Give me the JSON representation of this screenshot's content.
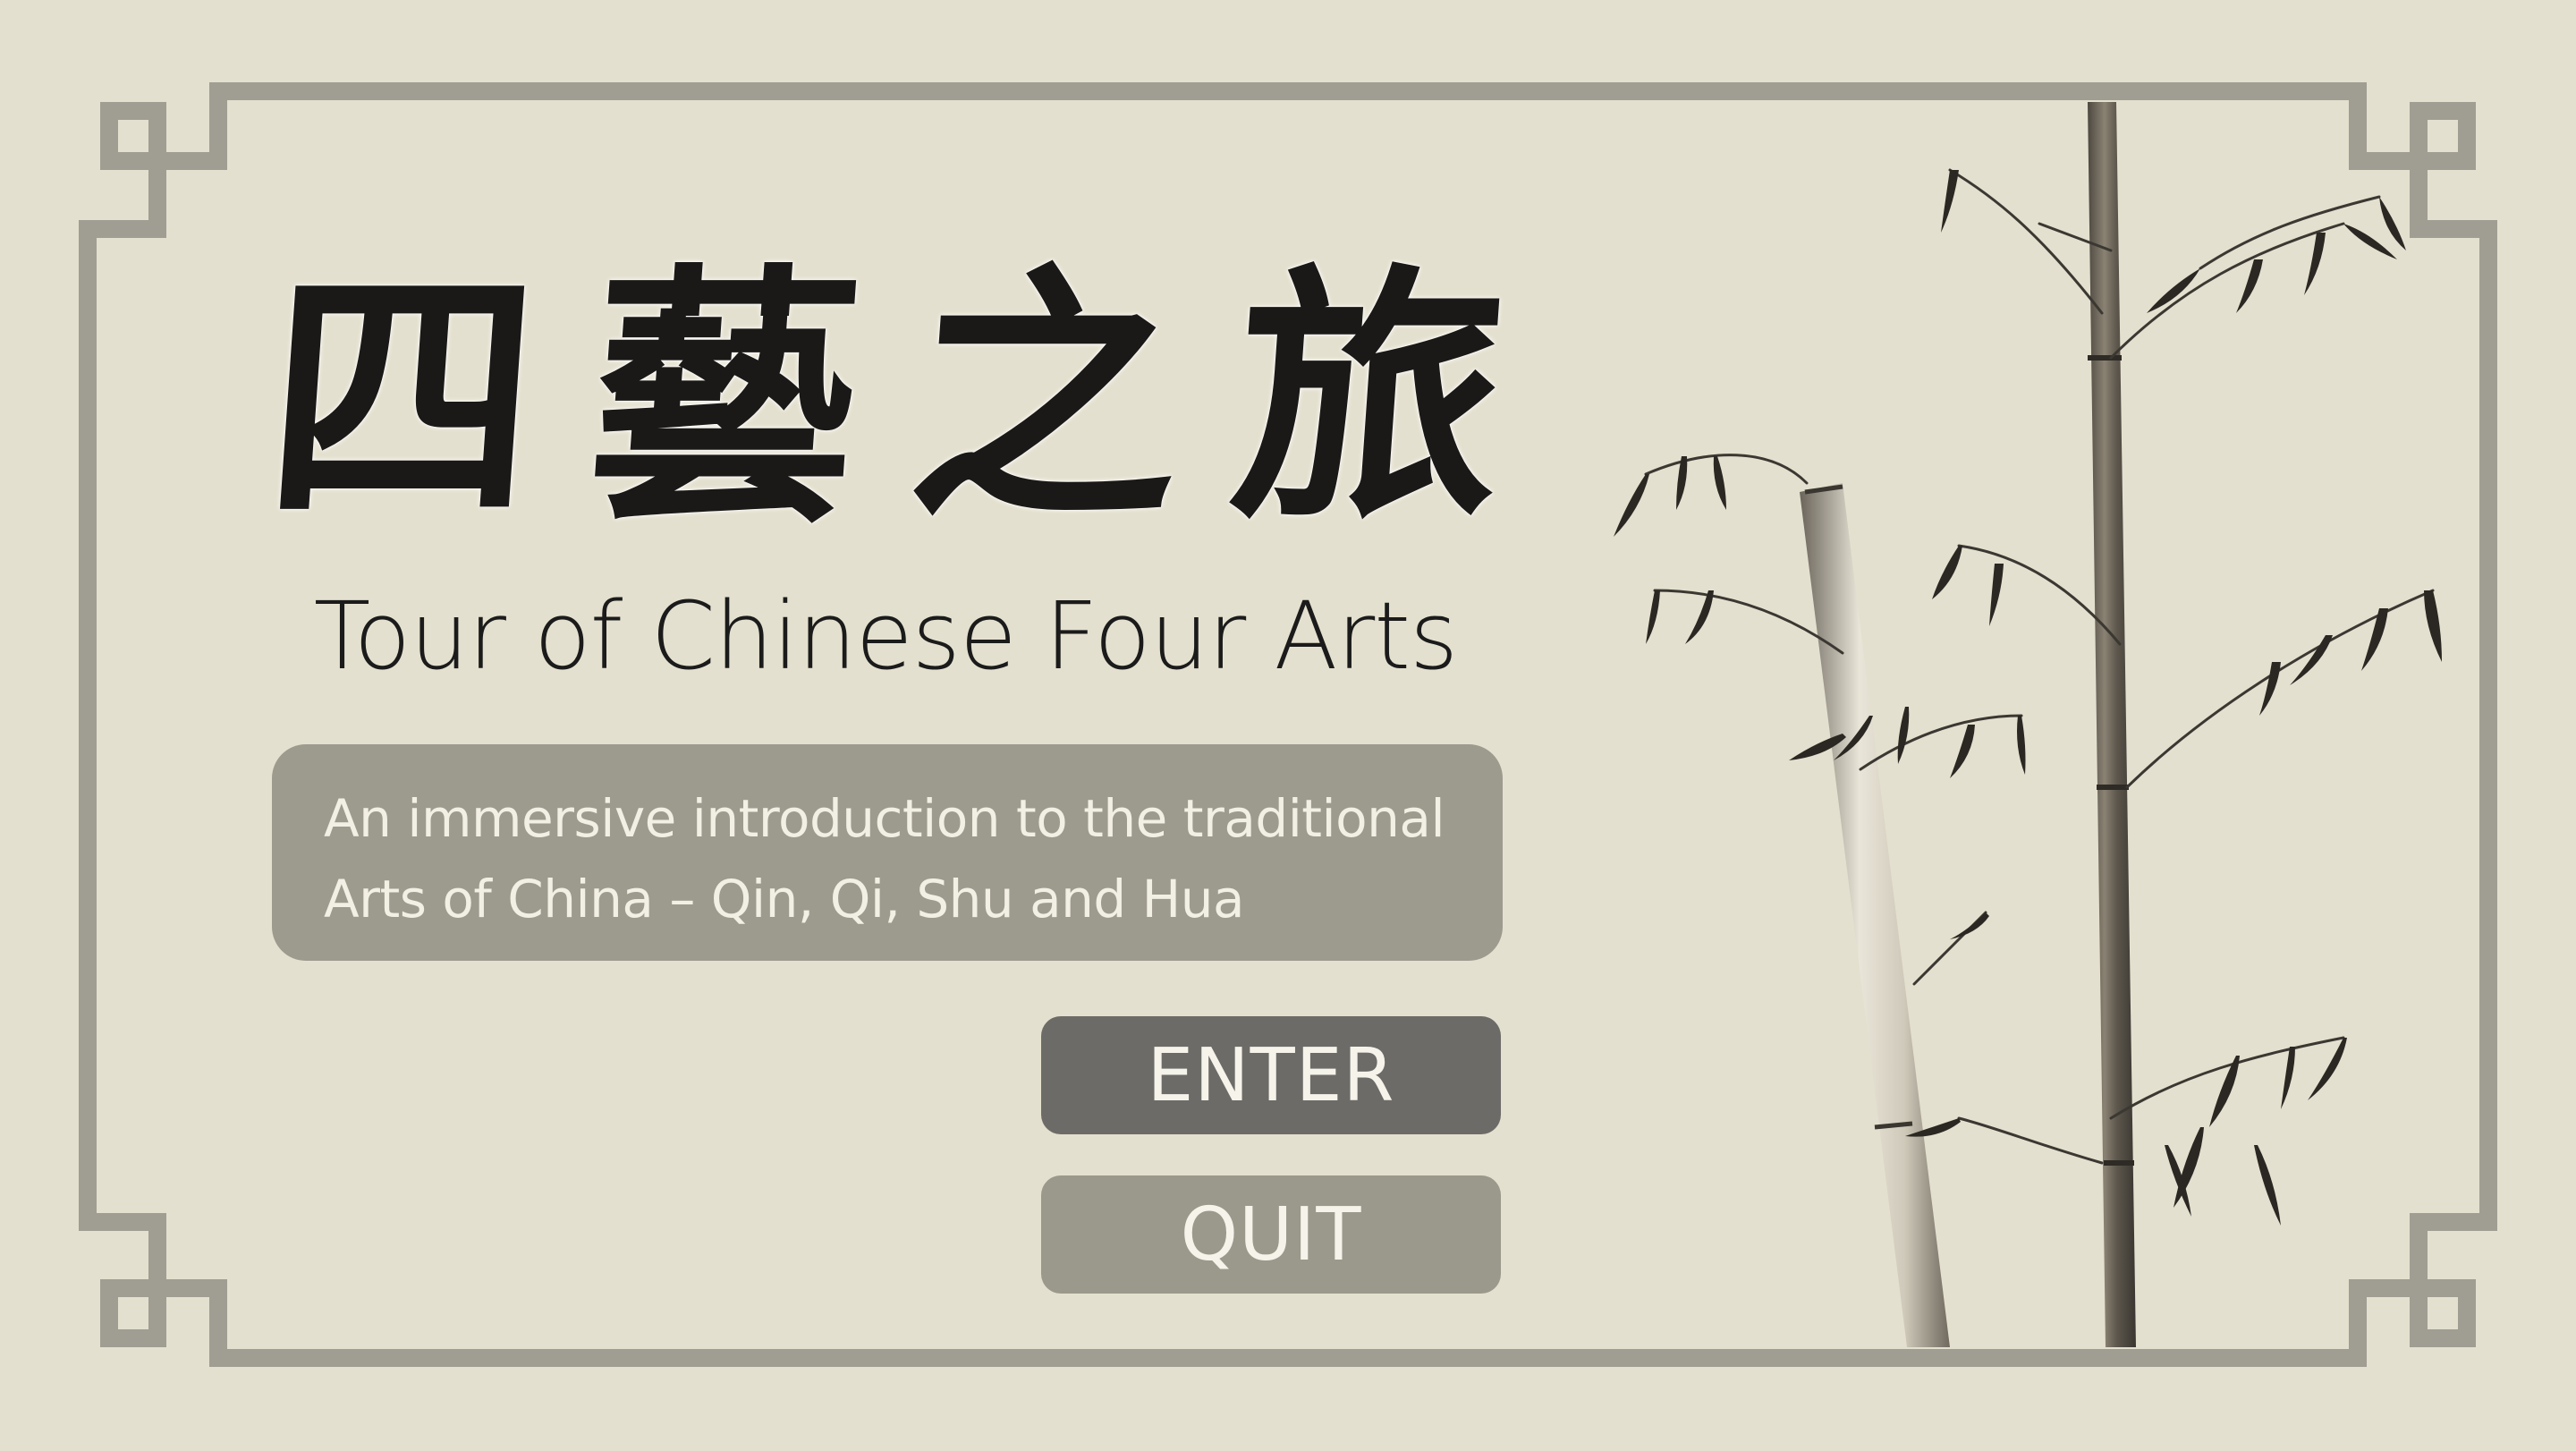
{
  "game": {
    "title_characters": [
      "四",
      "藝",
      "之",
      "旅"
    ],
    "subtitle": "Tour of Chinese Four Arts",
    "description_lines": [
      "An immersive introduction to the traditional",
      "Arts of China – Qin, Qi, Shu and Hua"
    ]
  },
  "menu": {
    "enter_label": "ENTER",
    "quit_label": "QUIT"
  },
  "colors": {
    "background": "#e4e0cf",
    "frame": "#a09d92",
    "description_box": "#9d9a8e",
    "enter_button": "#6c6b67",
    "quit_button": "#9b988c",
    "text_light": "#f2efe4",
    "ink": "#1b1917"
  },
  "decorations": {
    "frame": "chinese-fret-border",
    "illustration": "ink-bamboo"
  }
}
